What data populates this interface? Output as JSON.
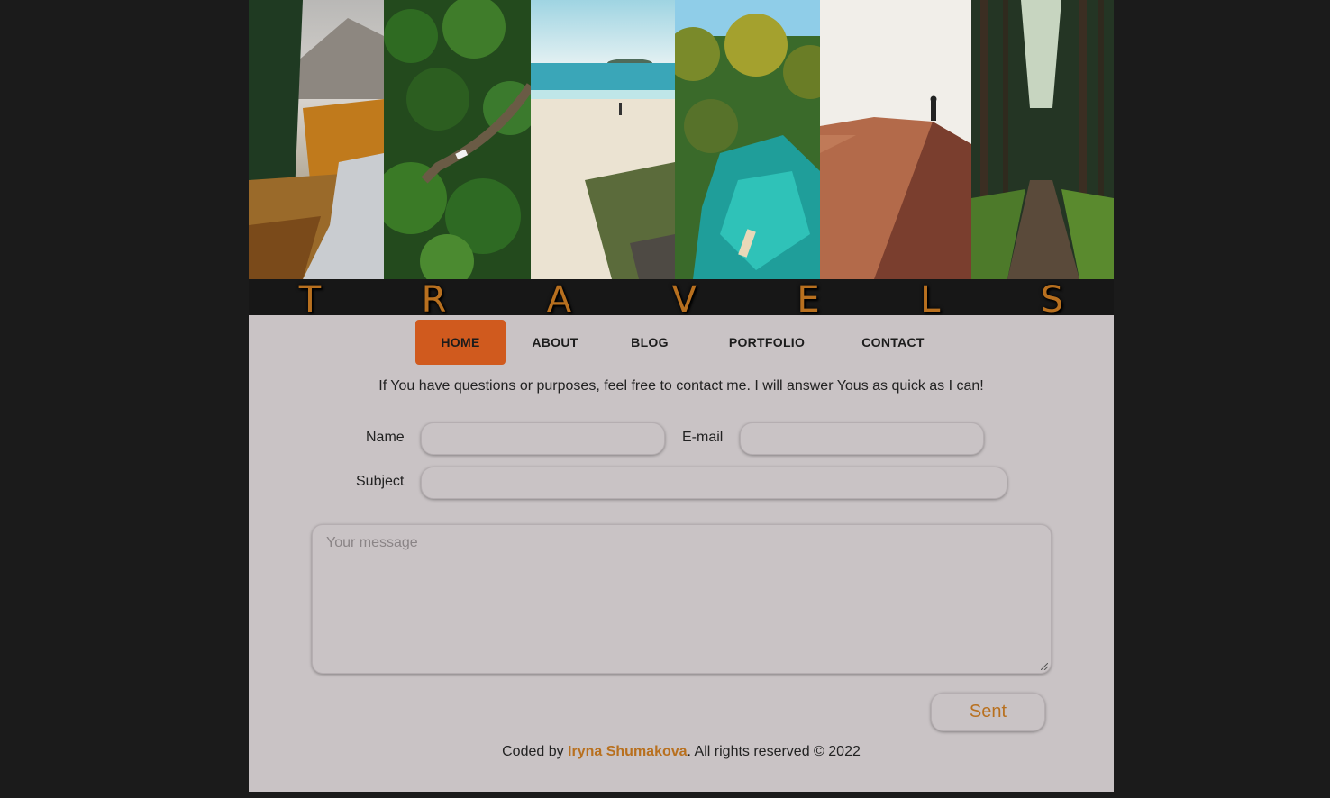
{
  "banner": {
    "photos": [
      "mountain-forest-photo",
      "aerial-forest-road-photo",
      "beach-photo",
      "tropical-lagoon-photo",
      "desert-dune-photo",
      "forest-path-photo"
    ],
    "title_letters": [
      "T",
      "R",
      "A",
      "V",
      "E",
      "L",
      "S"
    ],
    "accent_color": "#b8701f"
  },
  "nav": {
    "items": [
      {
        "label": "HOME",
        "active": true
      },
      {
        "label": "ABOUT"
      },
      {
        "label": "BLOG"
      },
      {
        "label": "PORTFOLIO"
      },
      {
        "label": "CONTACT"
      }
    ],
    "active_color": "#d05a1e"
  },
  "contact": {
    "intro": "If You have questions or purposes, feel free to contact me. I will answer Yous as quick as I can!",
    "name_label": "Name",
    "email_label": "E-mail",
    "subject_label": "Subject",
    "message_placeholder": "Your message",
    "submit_label": "Sent"
  },
  "footer": {
    "prefix": "Coded by ",
    "author": "Iryna Shumakova",
    "suffix": ". All rights reserved © 2022"
  }
}
